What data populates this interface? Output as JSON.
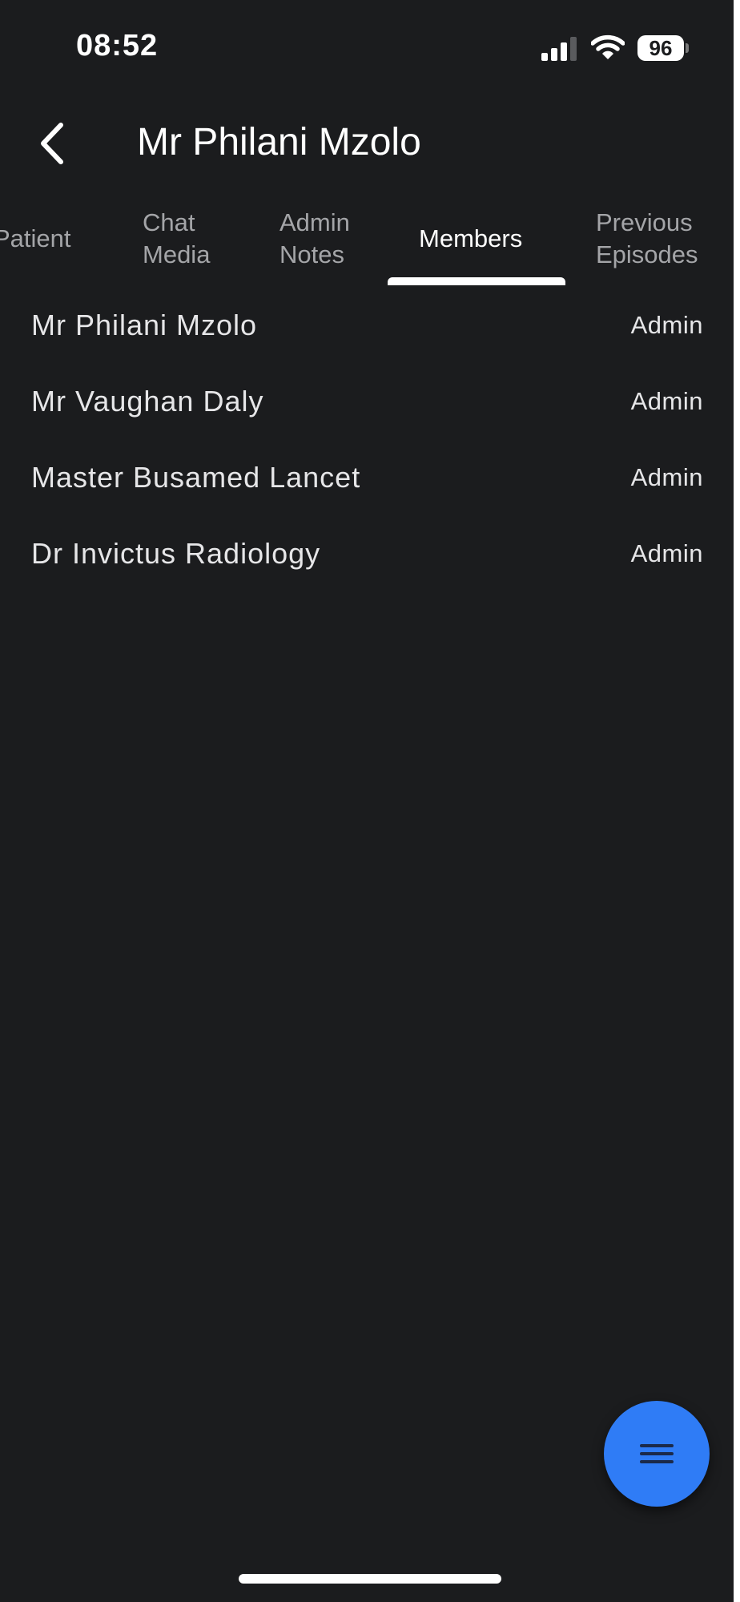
{
  "status_bar": {
    "time": "08:52",
    "battery_percent": "96",
    "signal_icon": "cellular-signal-icon",
    "wifi_icon": "wifi-icon"
  },
  "header": {
    "back_icon": "chevron-left-icon",
    "title": "Mr Philani Mzolo"
  },
  "tabs": [
    {
      "line1": "Patient",
      "line2": "",
      "active": false
    },
    {
      "line1": "Chat",
      "line2": "Media",
      "active": false
    },
    {
      "line1": "Admin",
      "line2": "Notes",
      "active": false
    },
    {
      "line1": "Members",
      "line2": "",
      "active": true
    },
    {
      "line1": "Previous",
      "line2": "Episodes",
      "active": false
    }
  ],
  "members": [
    {
      "name": "Mr Philani Mzolo",
      "role": "Admin"
    },
    {
      "name": "Mr Vaughan Daly",
      "role": "Admin"
    },
    {
      "name": "Master Busamed Lancet",
      "role": "Admin"
    },
    {
      "name": "Dr Invictus Radiology",
      "role": "Admin"
    }
  ],
  "fab": {
    "icon": "menu-icon"
  },
  "colors": {
    "background": "#1b1c1e",
    "accent": "#2f7cf6",
    "tab_inactive": "#a4a5a8",
    "text": "#e6e6e8"
  }
}
